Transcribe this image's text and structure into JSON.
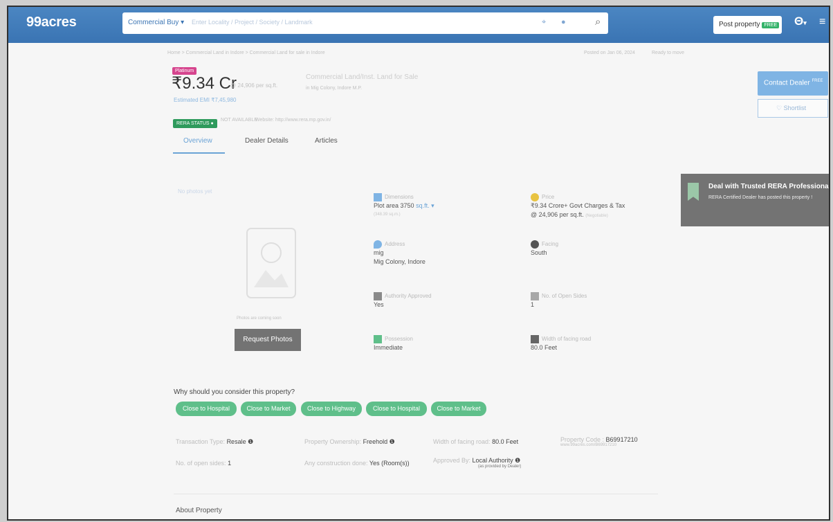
{
  "header": {
    "logo": "99acres",
    "search_category": "Commercial Buy ▾",
    "search_placeholder": "Enter Locality / Project / Society / Landmark",
    "post_property": "Post property",
    "post_badge": "FREE"
  },
  "listing": {
    "breadcrumb": "Home > Commercial Land in Indore > Commercial Land for sale in Indore",
    "posted": "Posted on Jan 06, 2024",
    "status": "Ready to move",
    "badge": "Platinum",
    "price": "₹9.34 Cr",
    "price_per": "@ 24,906 per sq.ft.",
    "title": "Commercial Land/Inst. Land for Sale",
    "subtitle": "in Mig Colony, Indore M.P.",
    "emi": "Estimated EMI ₹7,45,980",
    "rera_label": "RERA STATUS",
    "rera_value": "NOT AVAILABLE",
    "rera_website": "Website: http://www.rera.mp.gov.in/"
  },
  "tabs": [
    "Overview",
    "Dealer Details",
    "Articles"
  ],
  "actions": {
    "contact": "Contact Dealer",
    "contact_badge": "FREE",
    "shortlist": "Shortlist"
  },
  "rera_popup": {
    "title": "Deal with Trusted RERA Professionals",
    "text": "RERA Certified Dealer has posted this property !"
  },
  "photos": {
    "no_photo": "No photos yet",
    "caption": "Photos are coming soon",
    "request": "Request Photos"
  },
  "details": {
    "dimensions_label": "Dimensions",
    "plot_area": "Plot area 3750",
    "plot_unit": "sq.ft. ▾",
    "plot_sub": "(348.39 sq.m.)",
    "price_label": "Price",
    "price_value": "₹9.34 Crore+ Govt Charges & Tax",
    "price_per": "@ 24,906 per sq.ft.",
    "price_negotiable": "(Negotiable)",
    "address_label": "Address",
    "address_1": "mig",
    "address_2": "Mig Colony, Indore",
    "facing_label": "Facing",
    "facing_value": "South",
    "approved_label": "Authority Approved",
    "approved_value": "Yes",
    "open_label": "No. of Open Sides",
    "open_value": "1",
    "possession_label": "Possession",
    "possession_value": "Immediate",
    "width_label": "Width of facing road",
    "width_value": "80.0 Feet"
  },
  "why": {
    "heading": "Why should you consider this property?",
    "chips": [
      "Close to Hospital",
      "Close to Market",
      "Close to Highway",
      "Close to Hospital",
      "Close to Market"
    ]
  },
  "facts": {
    "transaction_label": "Transaction Type:",
    "transaction_value": "Resale",
    "ownership_label": "Property Ownership:",
    "ownership_value": "Freehold",
    "width_label": "Width of facing road:",
    "width_value": "80.0 Feet",
    "code_label": "Property Code :",
    "code_value": "B69917210",
    "code_sub": "www.99acres.com/B69917210",
    "open_label": "No. of open sides:",
    "open_value": "1",
    "construction_label": "Any construction done:",
    "construction_value": "Yes (Room(s))",
    "approved_label": "Approved By:",
    "approved_value": "Local Authority",
    "approved_sub": "(as provided by Dealer)"
  },
  "about": "About Property"
}
